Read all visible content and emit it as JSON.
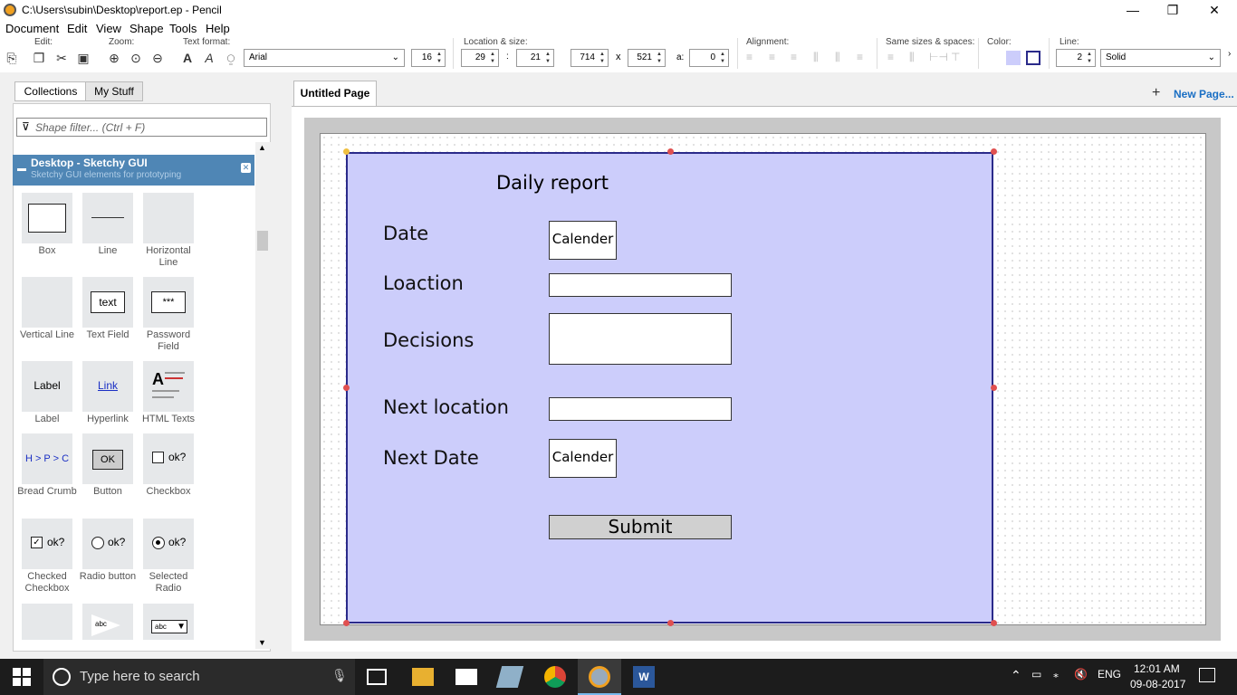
{
  "window": {
    "title": "C:\\Users\\subin\\Desktop\\report.ep - Pencil",
    "minimize": "—",
    "restore": "❐",
    "close": "✕"
  },
  "menu": [
    "Document",
    "Edit",
    "View",
    "Shape",
    "Tools",
    "Help"
  ],
  "toolbar": {
    "edit_label": "Edit:",
    "zoom_label": "Zoom:",
    "text_format_label": "Text format:",
    "font": "Arial",
    "font_size": "16",
    "location_label": "Location & size:",
    "x": "29",
    "colon": ":",
    "y": "21",
    "width": "714",
    "times": "x",
    "height": "521",
    "angle_label": "a:",
    "angle": "0",
    "alignment_label": "Alignment:",
    "same_sizes_label": "Same sizes & spaces:",
    "color_label": "Color:",
    "line_label": "Line:",
    "line_width": "2",
    "line_style": "Solid",
    "fill_color": "#cccdfb",
    "stroke_color": "#2a2a8a"
  },
  "left_panel": {
    "tabs": [
      "Collections",
      "My Stuff"
    ],
    "filter_placeholder": "Shape filter... (Ctrl + F)",
    "collection_title": "Desktop - Sketchy GUI",
    "collection_subtitle": "Sketchy GUI elements for prototyping",
    "items": [
      {
        "label": "Box",
        "icon": "box-shape"
      },
      {
        "label": "Line",
        "icon": "line-shape"
      },
      {
        "label": "Horizontal Line",
        "icon": "horizontal-line-shape"
      },
      {
        "label": "Vertical Line",
        "icon": "vertical-line-shape"
      },
      {
        "label": "Text Field",
        "icon": "text-field-shape",
        "preview": "text"
      },
      {
        "label": "Password Field",
        "icon": "password-field-shape",
        "preview": "***"
      },
      {
        "label": "Label",
        "icon": "label-shape",
        "preview": "Label"
      },
      {
        "label": "Hyperlink",
        "icon": "hyperlink-shape",
        "preview": "Link"
      },
      {
        "label": "HTML Texts",
        "icon": "html-texts-shape"
      },
      {
        "label": "Bread Crumb",
        "icon": "breadcrumb-shape",
        "preview": "H > P > C"
      },
      {
        "label": "Button",
        "icon": "button-shape",
        "preview": "OK"
      },
      {
        "label": "Checkbox",
        "icon": "checkbox-shape",
        "preview": "ok?"
      },
      {
        "label": "Checked Checkbox",
        "icon": "checked-checkbox-shape",
        "preview": "ok?"
      },
      {
        "label": "Radio button",
        "icon": "radio-button-shape",
        "preview": "ok?"
      },
      {
        "label": "Selected Radio",
        "icon": "selected-radio-shape",
        "preview": "ok?"
      }
    ],
    "partial_previews": [
      "abc",
      "abc"
    ]
  },
  "page_tab": "Untitled Page",
  "new_page": "New Page...",
  "design": {
    "title": "Daily report",
    "labels": [
      "Date",
      "Loaction",
      "Decisions",
      "Next location",
      "Next Date"
    ],
    "calendar1": "Calender",
    "calendar2": "Calender",
    "submit": "Submit"
  },
  "taskbar": {
    "search_placeholder": "Type here to search",
    "lang": "ENG",
    "time": "12:01 AM",
    "date": "09-08-2017"
  }
}
